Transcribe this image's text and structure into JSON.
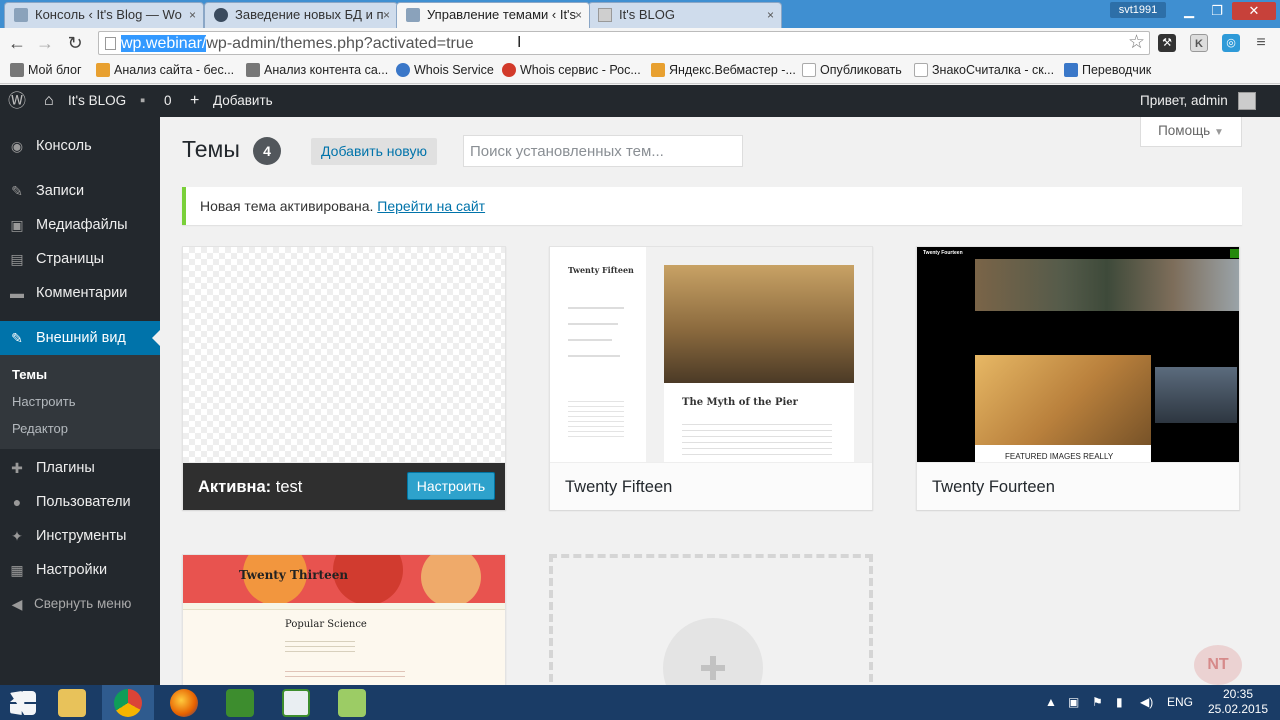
{
  "browser": {
    "tabs": [
      {
        "title": "Консоль ‹ It's Blog — Wo",
        "fav": "#8aa2bb"
      },
      {
        "title": "Заведение новых БД и п",
        "fav": "#3b4b5e"
      },
      {
        "title": "Управление темами ‹ It's",
        "fav": "#8aa2bb"
      },
      {
        "title": "It's BLOG",
        "fav": "#cfcfcf"
      }
    ],
    "close_glyph": "×",
    "user_badge": "svt1991",
    "url_selected": "wp.webinar/",
    "url_rest": "wp-admin/themes.php?activated=true",
    "bookmarks": [
      {
        "label": "Мой блог",
        "color": "#777777"
      },
      {
        "label": "Анализ сайта - бес...",
        "color": "#e8a030"
      },
      {
        "label": "Анализ контента са...",
        "color": "#777777"
      },
      {
        "label": "Whois Service",
        "color": "#3a77c8"
      },
      {
        "label": "Whois сервис - Рос...",
        "color": "#d23a2a"
      },
      {
        "label": "Яндекс.Вебмастер -...",
        "color": "#e8a030"
      },
      {
        "label": "Опубликовать",
        "color": "#aaaaaa"
      },
      {
        "label": "ЗнакоСчиталка - ск...",
        "color": "#aaaaaa"
      },
      {
        "label": "Переводчик",
        "color": "#3a77c8"
      }
    ]
  },
  "adminbar": {
    "site_name": "It's BLOG",
    "comments_count": "0",
    "add_new": "Добавить",
    "greeting": "Привет, admin"
  },
  "sidebar": {
    "items": [
      {
        "label": "Консоль",
        "icon": "dashboard-icon",
        "glyph": "◉"
      },
      {
        "label": "Записи",
        "icon": "pin-icon",
        "glyph": "✎"
      },
      {
        "label": "Медиафайлы",
        "icon": "media-icon",
        "glyph": "▣"
      },
      {
        "label": "Страницы",
        "icon": "pages-icon",
        "glyph": "▤"
      },
      {
        "label": "Комментарии",
        "icon": "comments-icon",
        "glyph": "▬"
      },
      {
        "label": "Внешний вид",
        "icon": "brush-icon",
        "glyph": "✎"
      },
      {
        "label": "Плагины",
        "icon": "plugin-icon",
        "glyph": "✚"
      },
      {
        "label": "Пользователи",
        "icon": "users-icon",
        "glyph": "●"
      },
      {
        "label": "Инструменты",
        "icon": "wrench-icon",
        "glyph": "✦"
      },
      {
        "label": "Настройки",
        "icon": "settings-icon",
        "glyph": "▦"
      },
      {
        "label": "Свернуть меню",
        "icon": "collapse-icon",
        "glyph": "◀"
      }
    ],
    "submenu": [
      "Темы",
      "Настроить",
      "Редактор"
    ]
  },
  "main": {
    "title": "Темы",
    "count": "4",
    "add_new": "Добавить новую",
    "search_placeholder": "Поиск установленных тем...",
    "help": "Помощь",
    "notice_text": "Новая тема активирована.",
    "notice_link": "Перейти на сайт",
    "active_label": "Активна:",
    "active_name": "test",
    "customize": "Настроить",
    "themes": [
      "Twenty Fifteen",
      "Twenty Fourteen",
      "Twenty Thirteen"
    ],
    "preview": {
      "fifteen_title": "Twenty Fifteen",
      "fifteen_post": "The Myth of the Pier",
      "fourteen_title": "Twenty Fourteen",
      "fourteen_headline": "FEATURED IMAGES REALLY",
      "thirteen_title": "Twenty Thirteen",
      "thirteen_post": "Popular Science"
    }
  },
  "taskbar": {
    "lang": "ENG",
    "time": "20:35",
    "date": "25.02.2015"
  },
  "watermark": "NT",
  "colors": {
    "admin_dark": "#23282d",
    "accent": "#0073aa",
    "notice_green": "#7ad03a",
    "taskbar": "#1a3c66"
  }
}
